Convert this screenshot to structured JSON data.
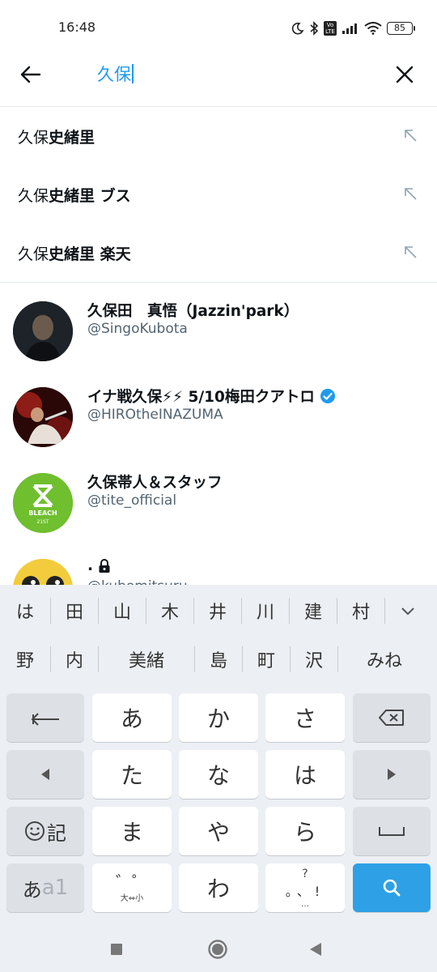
{
  "status_bar": {
    "time": "16:48",
    "battery": "85",
    "volte": "Vo LTE"
  },
  "search": {
    "query": "久保"
  },
  "suggestions": [
    {
      "prefix": "久保",
      "rest": "史緒里"
    },
    {
      "prefix": "久保",
      "rest": "史緒里 ブス"
    },
    {
      "prefix": "久保",
      "rest": "史緒里 楽天"
    }
  ],
  "users": [
    {
      "name": "久保田　真悟（Jazzin'park）",
      "handle": "@SingoKubota",
      "verified": false
    },
    {
      "name": "イナ戦久保⚡⚡ 5/10梅田クアトロ",
      "handle": "@HIROtheINAZUMA",
      "verified": true
    },
    {
      "name": "久保帯人＆スタッフ",
      "handle": "@tite_official",
      "verified": false
    },
    {
      "name": ".",
      "handle": "@kubomitsuru",
      "verified": false
    }
  ],
  "avatar_text": {
    "bleach": "BLEACH",
    "bleach_sub": "21ST"
  },
  "keyboard": {
    "candidates_row1": [
      "は",
      "田",
      "山",
      "木",
      "井",
      "川",
      "建",
      "村"
    ],
    "candidates_row2": [
      "野",
      "内",
      "美緒",
      "島",
      "町",
      "沢",
      "みね"
    ],
    "keys": {
      "a": "あ",
      "ka": "か",
      "sa": "さ",
      "ta": "た",
      "na": "な",
      "ha": "は",
      "ma": "ま",
      "ya": "や",
      "ra": "ら",
      "wa": "わ",
      "emoji_label": "記",
      "mode_a": "あ",
      "mode_1": "a1",
      "dakuten_top": "゛゜",
      "dakuten_bottom": "大⇔小",
      "punct_top": "?",
      "punct_mid": "。、!",
      "punct_bottom": "…"
    }
  },
  "colors": {
    "accent": "#1d9bf0",
    "secondary_text": "#536471",
    "search_key": "#2da0e6"
  }
}
